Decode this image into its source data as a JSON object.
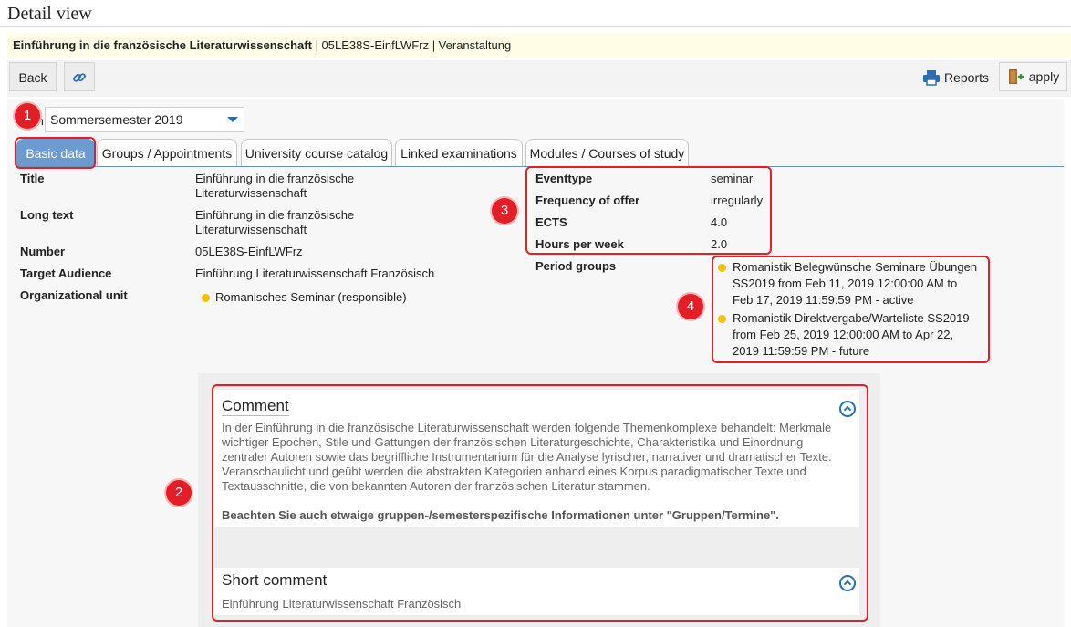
{
  "page": {
    "title": "Detail view"
  },
  "headline": {
    "course_name": "Einführung in die französische Literaturwissenschaft",
    "rest": " | 05LE38S-EinfLWFrz | Veranstaltung"
  },
  "toolbar": {
    "back_label": "Back",
    "reports_label": "Reports",
    "apply_label": "apply"
  },
  "term": {
    "label": "Term",
    "value": "Sommersemester 2019"
  },
  "tabs": [
    {
      "label": "Basic data"
    },
    {
      "label": "Groups / Appointments"
    },
    {
      "label": "University course catalog"
    },
    {
      "label": "Linked examinations"
    },
    {
      "label": "Modules / Courses of study"
    }
  ],
  "basic": {
    "title_label": "Title",
    "title_value_1": "Einführung in die französische",
    "title_value_2": "Literaturwissenschaft",
    "longtext_label": "Long text",
    "longtext_value_1": "Einführung in die französische",
    "longtext_value_2": "Literaturwissenschaft",
    "number_label": "Number",
    "number_value": "05LE38S-EinfLWFrz",
    "audience_label": "Target Audience",
    "audience_value": "Einführung Literaturwissenschaft Französisch",
    "orgunit_label": "Organizational unit",
    "orgunit_value": "Romanisches Seminar (responsible)"
  },
  "details": {
    "eventtype_label": "Eventtype",
    "eventtype_value": "seminar",
    "frequency_label": "Frequency of offer",
    "frequency_value": "irregularly",
    "ects_label": "ECTS",
    "ects_value": "4.0",
    "hours_label": "Hours per week",
    "hours_value": "2.0",
    "period_label": "Period groups",
    "period_1": [
      "Romanistik Belegwünsche Seminare Übungen",
      "SS2019 from Feb 11, 2019 12:00:00 AM to",
      "Feb 17, 2019 11:59:59 PM - active"
    ],
    "period_2": [
      "Romanistik Direktvergabe/Warteliste SS2019",
      "from Feb 25, 2019 12:00:00 AM to Apr 22,",
      "2019 11:59:59 PM - future"
    ]
  },
  "markers": [
    "1",
    "2",
    "3",
    "4"
  ],
  "comment": {
    "heading": "Comment",
    "lines": [
      "In der Einführung in die französische Literaturwissenschaft werden folgende Themenkomplexe behandelt: Merkmale",
      "wichtiger Epochen, Stile und Gattungen der französischen Literaturgeschichte, Charakteristika und Einordnung",
      "zentraler Autoren sowie das begriffliche Instrumentarium für die Analyse lyrischer, narrativer und dramatischer Texte.",
      "Veranschaulicht und geübt werden die abstrakten Kategorien anhand eines Korpus paradigmatischer Texte und",
      "Textausschnitte, die von bekannten Autoren der französischen Literatur stammen."
    ],
    "note": "Beachten Sie auch etwaige gruppen-/semesterspezifische Informationen unter \"Gruppen/Termine\"."
  },
  "short_comment": {
    "heading": "Short comment",
    "text": "Einführung Literaturwissenschaft Französisch"
  },
  "colors": {
    "accent": "#2a6fb5",
    "tab_active": "#6b9bd1",
    "annotation": "#e41e26",
    "status_dot": "#f2c300"
  }
}
